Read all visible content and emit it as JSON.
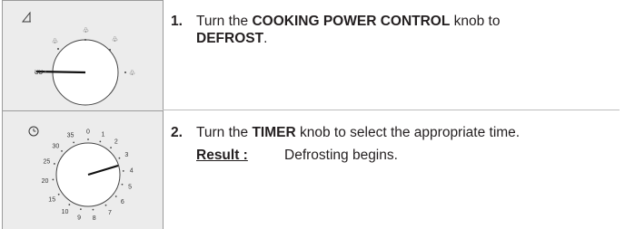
{
  "steps": [
    {
      "number": "1.",
      "line1_prefix": "Turn the ",
      "line1_bold": "COOKING POWER CONTROL",
      "line1_suffix": " knob to",
      "line2_bold": "DEFROST",
      "line2_suffix": "."
    },
    {
      "number": "2.",
      "line1_prefix": "Turn the ",
      "line1_bold": "TIMER",
      "line1_suffix": " knob to select the appropriate time.",
      "result_label": "Result :",
      "result_text": "Defrosting begins."
    }
  ],
  "timer_dial": {
    "tick_labels": [
      "0",
      "1",
      "2",
      "3",
      "4",
      "5",
      "6",
      "7",
      "8",
      "9",
      "10",
      "15",
      "20",
      "25",
      "30",
      "35"
    ],
    "icon": "clock-icon"
  },
  "power_dial": {
    "icon": "power-level-icon",
    "setting_icons": [
      "defrost-icon",
      "low-icon",
      "medium-icon",
      "high-icon",
      "keep-warm-icon"
    ]
  }
}
